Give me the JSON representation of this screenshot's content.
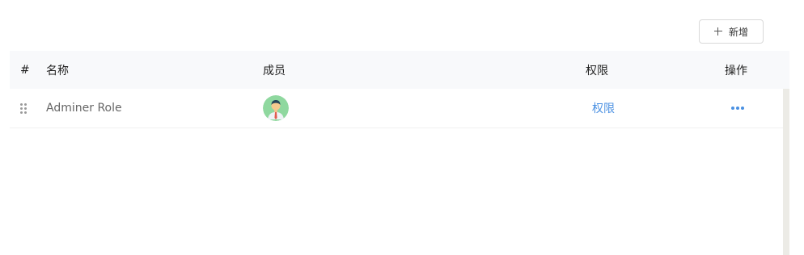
{
  "toolbar": {
    "add_label": "新增"
  },
  "table": {
    "columns": {
      "index": "#",
      "name": "名称",
      "members": "成员",
      "permissions": "权限",
      "actions": "操作"
    },
    "rows": [
      {
        "name": "Adminer Role",
        "member_avatar": "avatar-icon",
        "permission_link": "权限",
        "actions_icon": "more-icon"
      }
    ]
  },
  "colors": {
    "link": "#4a90e2",
    "header_bg": "#f8f9fb",
    "avatar_bg": "#8fd89f"
  }
}
